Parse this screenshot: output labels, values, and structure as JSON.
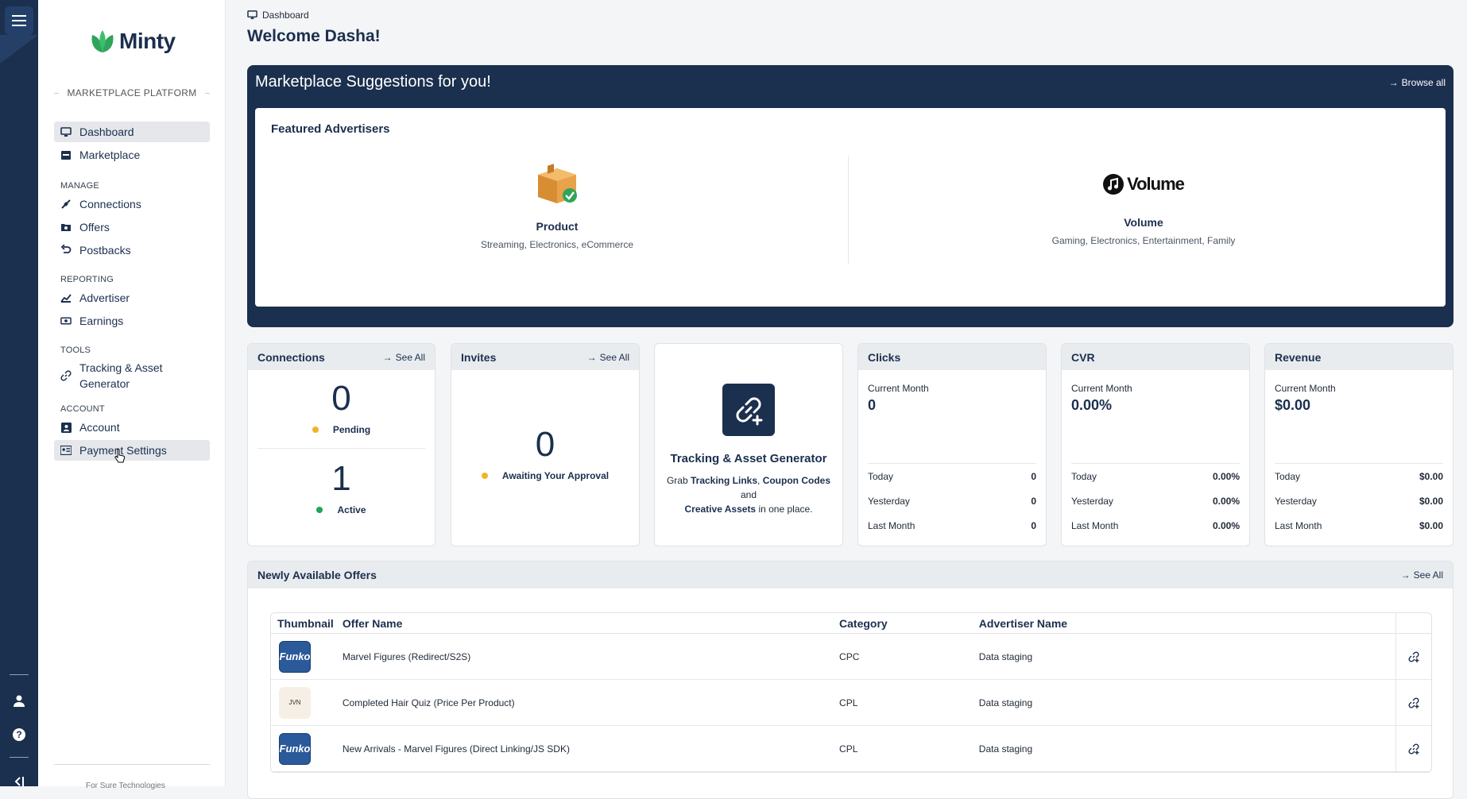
{
  "app": {
    "name": "Minty",
    "platform": "MARKETPLACE PLATFORM",
    "footer": "For Sure Technologies"
  },
  "sidebar": {
    "main_items": [
      {
        "label": "Dashboard",
        "icon": "monitor-icon",
        "active": true
      },
      {
        "label": "Marketplace",
        "icon": "store-icon"
      }
    ],
    "sections": [
      {
        "title": "MANAGE",
        "items": [
          {
            "label": "Connections",
            "icon": "plug-icon"
          },
          {
            "label": "Offers",
            "icon": "folder-star-icon"
          },
          {
            "label": "Postbacks",
            "icon": "undo-icon"
          }
        ]
      },
      {
        "title": "REPORTING",
        "items": [
          {
            "label": "Advertiser",
            "icon": "chart-icon"
          },
          {
            "label": "Earnings",
            "icon": "money-icon"
          }
        ]
      },
      {
        "title": "TOOLS",
        "items": [
          {
            "label": "Tracking & Asset Generator",
            "icon": "link-icon"
          }
        ]
      },
      {
        "title": "ACCOUNT",
        "items": [
          {
            "label": "Account",
            "icon": "id-card-icon"
          },
          {
            "label": "Payment Settings",
            "icon": "payment-icon",
            "hover": true
          }
        ]
      }
    ]
  },
  "header": {
    "breadcrumb": "Dashboard",
    "welcome": "Welcome Dasha!"
  },
  "suggestions": {
    "title": "Marketplace Suggestions for you!",
    "browse_label": "Browse all",
    "featured_title": "Featured Advertisers",
    "advertisers": [
      {
        "name": "Product",
        "categories": "Streaming, Electronics, eCommerce",
        "logo": "package-icon"
      },
      {
        "name": "Volume",
        "categories": "Gaming, Electronics, Entertainment, Family",
        "logo_text": "Volume"
      }
    ]
  },
  "cards": {
    "connections": {
      "title": "Connections",
      "see_all": "See All",
      "pending_count": "0",
      "pending_label": "Pending",
      "active_count": "1",
      "active_label": "Active"
    },
    "invites": {
      "title": "Invites",
      "see_all": "See All",
      "count": "0",
      "label": "Awaiting Your Approval"
    },
    "tracking": {
      "title": "Tracking & Asset Generator",
      "text_pre": "Grab ",
      "link1": "Tracking Links",
      "sep1": ", ",
      "link2": "Coupon Codes",
      "sep2": " and ",
      "link3": "Creative Assets",
      "text_post": " in one place."
    },
    "clicks": {
      "title": "Clicks",
      "period": "Current Month",
      "value": "0",
      "today_label": "Today",
      "today": "0",
      "yesterday_label": "Yesterday",
      "yesterday": "0",
      "last_month_label": "Last Month",
      "last_month": "0"
    },
    "cvr": {
      "title": "CVR",
      "period": "Current Month",
      "value": "0.00%",
      "today_label": "Today",
      "today": "0.00%",
      "yesterday_label": "Yesterday",
      "yesterday": "0.00%",
      "last_month_label": "Last Month",
      "last_month": "0.00%"
    },
    "revenue": {
      "title": "Revenue",
      "period": "Current Month",
      "value": "$0.00",
      "today_label": "Today",
      "today": "$0.00",
      "yesterday_label": "Yesterday",
      "yesterday": "$0.00",
      "last_month_label": "Last Month",
      "last_month": "$0.00"
    }
  },
  "offers": {
    "title": "Newly Available Offers",
    "see_all": "See All",
    "columns": [
      "Thumbnail",
      "Offer Name",
      "Category",
      "Advertiser Name"
    ],
    "rows": [
      {
        "thumb": "Funko",
        "name": "Marvel Figures (Redirect/S2S)",
        "category": "CPC",
        "advertiser": "Data staging"
      },
      {
        "thumb": "JVN",
        "name": "Completed Hair Quiz (Price Per Product)",
        "category": "CPL",
        "advertiser": "Data staging"
      },
      {
        "thumb": "Funko",
        "name": "New Arrivals - Marvel Figures (Direct Linking/JS SDK)",
        "category": "CPL",
        "advertiser": "Data staging"
      }
    ]
  },
  "colors": {
    "navy": "#1b2f4e",
    "pending": "#f0b429",
    "active": "#22a35a",
    "brand_green": "#2fa45b"
  }
}
